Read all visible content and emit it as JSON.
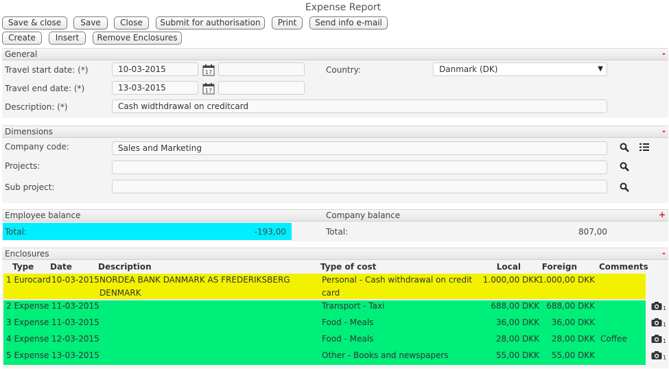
{
  "title": "Expense Report",
  "toolbar": {
    "save_close": "Save & close",
    "save": "Save",
    "close": "Close",
    "submit": "Submit for authorisation",
    "print": "Print",
    "send_email": "Send info e-mail",
    "create": "Create",
    "insert": "Insert",
    "remove_enclosures": "Remove Enclosures"
  },
  "general": {
    "title": "General",
    "collapse": "-",
    "travel_start_label": "Travel start date: (*)",
    "travel_start_value": "10-03-2015",
    "travel_start_extra": "",
    "travel_end_label": "Travel end date: (*)",
    "travel_end_value": "13-03-2015",
    "travel_end_extra": "",
    "country_label": "Country:",
    "country_value": "Danmark (DK)",
    "dropdown_arrow": "▼",
    "description_label": "Description: (*)",
    "description_value": "Cash widthdrawal on creditcard"
  },
  "dimensions": {
    "title": "Dimensions",
    "collapse": "-",
    "company_code_label": "Company code:",
    "company_code_value": "Sales and Marketing",
    "projects_label": "Projects:",
    "projects_value": "",
    "sub_project_label": "Sub project:",
    "sub_project_value": ""
  },
  "balance": {
    "employee_title": "Employee balance",
    "company_title": "Company balance",
    "collapse": "+",
    "employee_total_label": "Total:",
    "employee_total_value": "-193,00",
    "company_total_label": "Total:",
    "company_total_value": "807,00",
    "employee_highlight_color": "#00eeff"
  },
  "enclosures": {
    "title": "Enclosures",
    "collapse": "-",
    "headers": {
      "type": "Type",
      "date": "Date",
      "description": "Description",
      "type_of_cost": "Type of cost",
      "local": "Local",
      "foreign": "Foreign",
      "comments": "Comments"
    },
    "colors": {
      "card": "#f2f200",
      "expense": "#00ee7a"
    },
    "rows": [
      {
        "type": "1 Eurocard",
        "date": "10-03-2015",
        "description_line1": "NORDEA BANK DANMARK AS FREDERIKSBERG",
        "description_line2": "DENMARK",
        "cost_line1": "Personal - Cash withdrawal on credit",
        "cost_line2": "card",
        "local": "1.000,00 DKK",
        "foreign": "1.000,00 DKK",
        "comments": "",
        "attachments": ""
      },
      {
        "type": "2 Expense",
        "date": "11-03-2015",
        "description_line1": "",
        "description_line2": "",
        "cost_line1": "Transport - Taxi",
        "cost_line2": "",
        "local": "688,00 DKK",
        "foreign": "688,00 DKK",
        "comments": "",
        "attachments": "1"
      },
      {
        "type": "3 Expense",
        "date": "11-03-2015",
        "description_line1": "",
        "description_line2": "",
        "cost_line1": "Food - Meals",
        "cost_line2": "",
        "local": "36,00 DKK",
        "foreign": "36,00 DKK",
        "comments": "",
        "attachments": "1"
      },
      {
        "type": "4 Expense",
        "date": "12-03-2015",
        "description_line1": "",
        "description_line2": "",
        "cost_line1": "Food - Meals",
        "cost_line2": "",
        "local": "28,00 DKK",
        "foreign": "28,00 DKK",
        "comments": "Coffee",
        "attachments": "1"
      },
      {
        "type": "5 Expense",
        "date": "13-03-2015",
        "description_line1": "",
        "description_line2": "",
        "cost_line1": "Other - Books and newspapers",
        "cost_line2": "",
        "local": "55,00 DKK",
        "foreign": "55,00 DKK",
        "comments": "",
        "attachments": "1"
      }
    ]
  },
  "icons": {
    "calendar": "calendar-icon",
    "search": "search-icon",
    "list": "list-icon",
    "camera": "camera-icon"
  }
}
